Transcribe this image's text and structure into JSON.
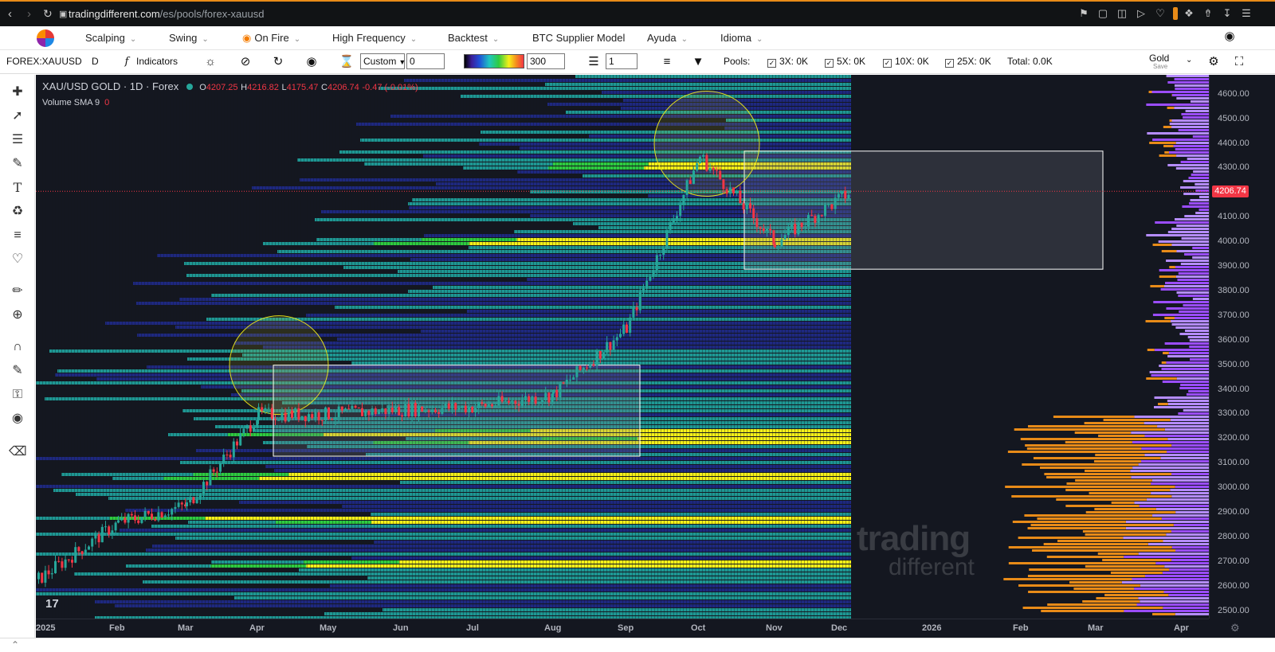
{
  "browser": {
    "url_domain": "tradingdifferent.com",
    "url_path": "/es/pools/forex-xauusd"
  },
  "menu": {
    "items": [
      {
        "label": "Scalping"
      },
      {
        "label": "Swing"
      },
      {
        "label": "On Fire"
      },
      {
        "label": "High Frequency"
      },
      {
        "label": "Backtest"
      },
      {
        "label": "BTC Supplier Model"
      },
      {
        "label": "Ayuda"
      },
      {
        "label": "Idioma"
      }
    ]
  },
  "toolbar": {
    "symbol": "FOREX:XAUUSD",
    "interval": "D",
    "indicators_label": "Indicators",
    "custom_select": "Custom",
    "custom_value": "0",
    "gradient_value": "300",
    "layers_value": "1",
    "pools_label": "Pools:",
    "pool_3x": "3X: 0K",
    "pool_5x": "5X: 0K",
    "pool_10x": "10X: 0K",
    "pool_25x": "25X: 0K",
    "total": "Total: 0.0K",
    "layout_name": "Gold",
    "layout_sub": "Save"
  },
  "chart": {
    "title": "XAU/USD GOLD · 1D · Forex",
    "ohlc": {
      "o": "4207.25",
      "h": "4216.82",
      "l": "4175.47",
      "c": "4206.74",
      "chg": "-0.47 (-0.01%)"
    },
    "indicator": "Volume SMA 9",
    "indicator_value": "0",
    "last_price": "4206.74",
    "price_ticks": [
      "4600.00",
      "4500.00",
      "4400.00",
      "4300.00",
      "4100.00",
      "4000.00",
      "3900.00",
      "3800.00",
      "3700.00",
      "3600.00",
      "3500.00",
      "3400.00",
      "3300.00",
      "3200.00",
      "3100.00",
      "3000.00",
      "2900.00",
      "2800.00",
      "2700.00",
      "2600.00",
      "2500.00"
    ],
    "time_ticks": [
      "2025",
      "Feb",
      "Mar",
      "Apr",
      "May",
      "Jun",
      "Jul",
      "Aug",
      "Sep",
      "Oct",
      "Nov",
      "Dec",
      "2026",
      "Feb",
      "Mar",
      "Apr"
    ],
    "watermark_1": "trading",
    "watermark_2": "different",
    "colors": {
      "bg": "#141720",
      "up": "#26a69a",
      "down": "#f23645",
      "heat_low": "#1f2a8a",
      "heat_mid": "#1fa5a0",
      "heat_hi": "#f5f019"
    }
  },
  "chart_data": {
    "type": "heatmap",
    "title": "XAU/USD GOLD · 1D · Forex",
    "ylim": [
      2470,
      4680
    ],
    "x_range": [
      "2025-01",
      "2026-04"
    ],
    "price_path": [
      {
        "x": "2025-01",
        "y": 2630
      },
      {
        "x": "2025-02",
        "y": 2860
      },
      {
        "x": "2025-03",
        "y": 2930
      },
      {
        "x": "2025-04",
        "y": 3300
      },
      {
        "x": "2025-05",
        "y": 3300
      },
      {
        "x": "2025-06",
        "y": 3320
      },
      {
        "x": "2025-07",
        "y": 3330
      },
      {
        "x": "2025-08",
        "y": 3380
      },
      {
        "x": "2025-09",
        "y": 3650
      },
      {
        "x": "2025-10",
        "y": 4350
      },
      {
        "x": "2025-11",
        "y": 4000
      },
      {
        "x": "2025-12",
        "y": 4206.74
      }
    ]
  }
}
